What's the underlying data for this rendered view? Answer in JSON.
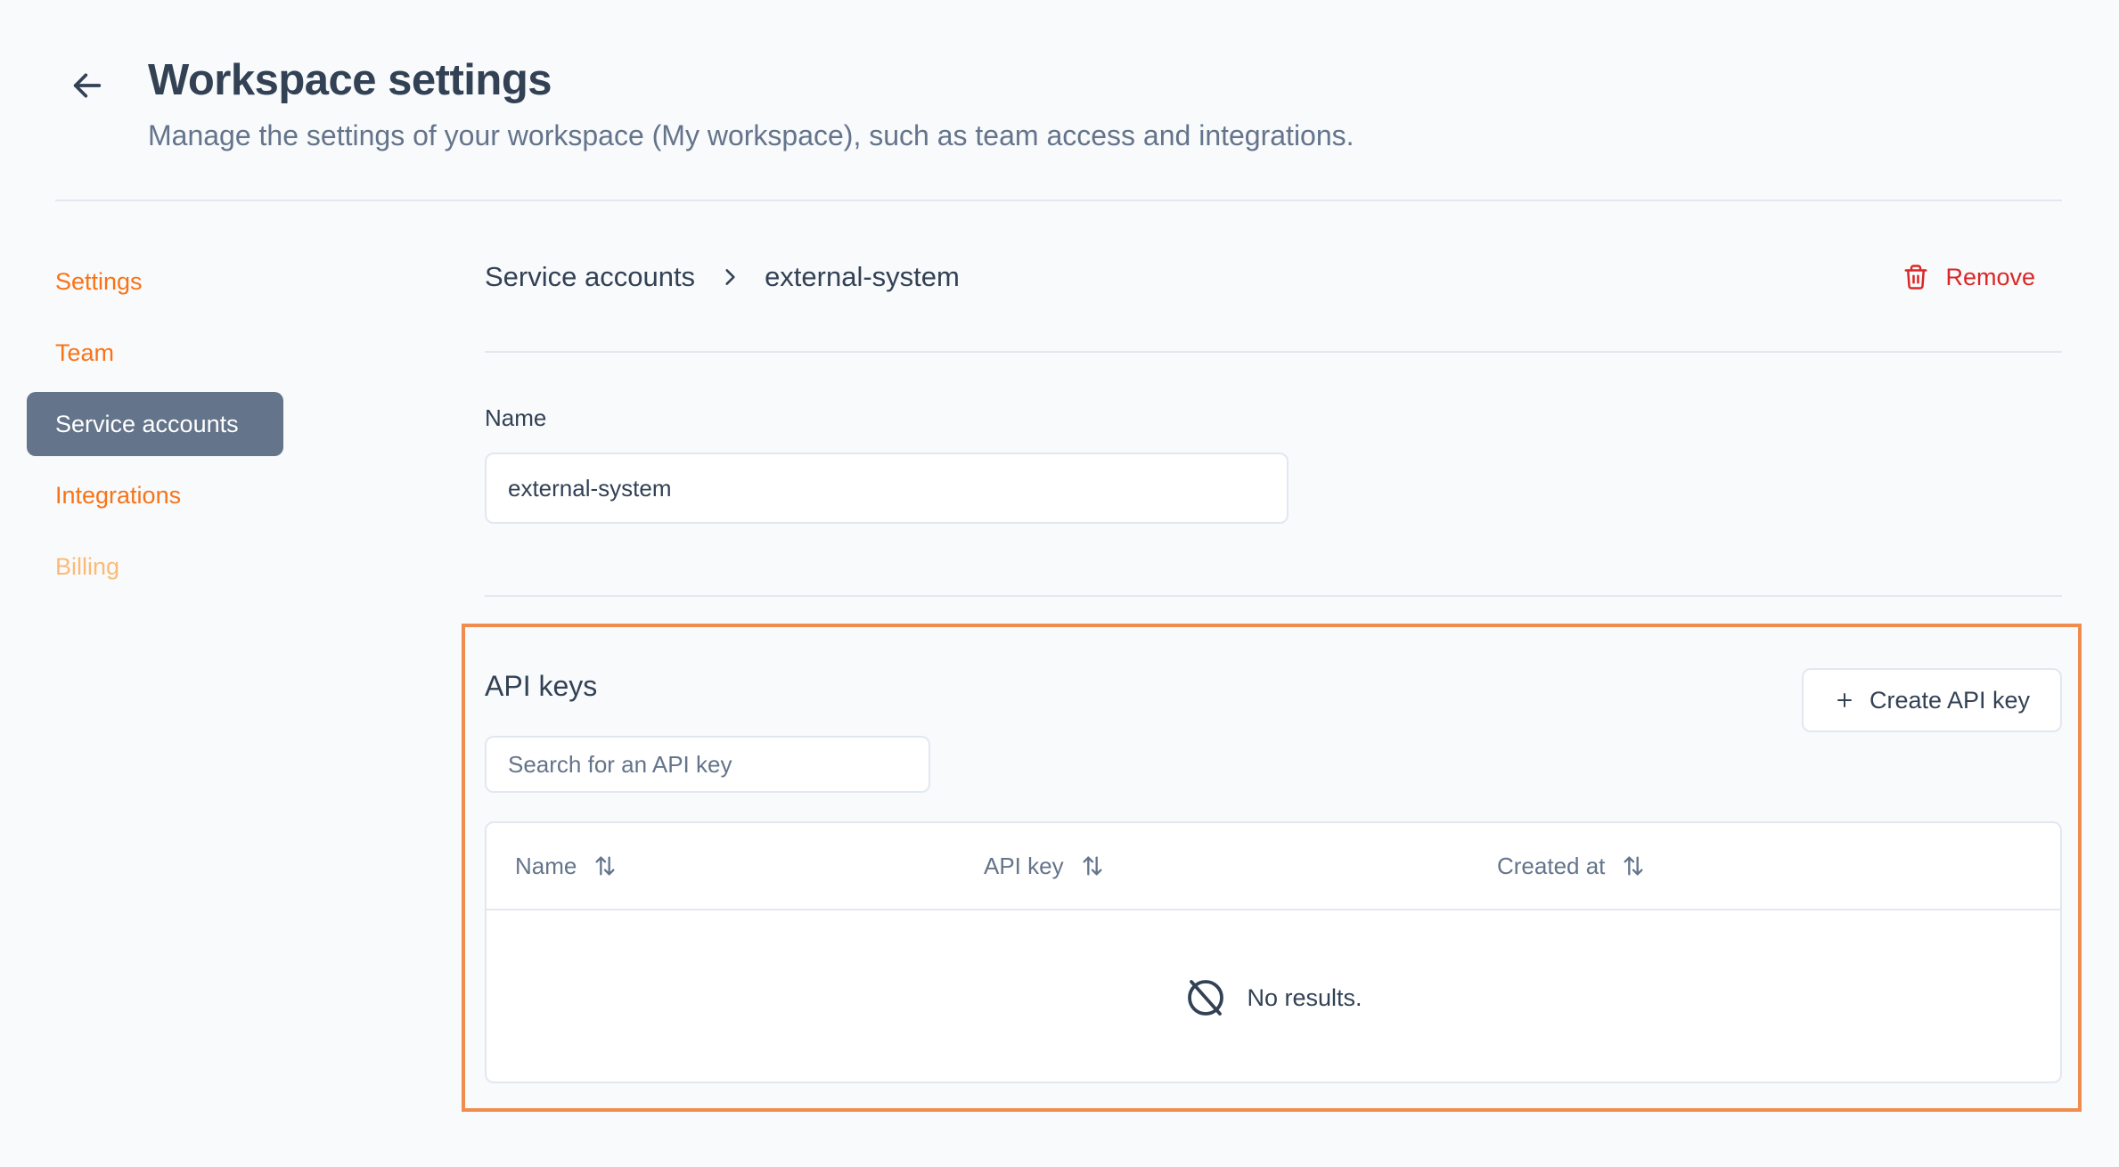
{
  "header": {
    "title": "Workspace settings",
    "subtitle": "Manage the settings of your workspace (My workspace), such as team access and integrations.",
    "back_icon": "arrow-left-icon"
  },
  "sidebar": {
    "items": [
      {
        "label": "Settings",
        "state": "default"
      },
      {
        "label": "Team",
        "state": "default"
      },
      {
        "label": "Service accounts",
        "state": "active"
      },
      {
        "label": "Integrations",
        "state": "default"
      },
      {
        "label": "Billing",
        "state": "disabled"
      }
    ]
  },
  "breadcrumb": {
    "parent": "Service accounts",
    "current": "external-system",
    "separator_icon": "chevron-right-icon"
  },
  "actions": {
    "remove_label": "Remove",
    "remove_icon": "trash-icon"
  },
  "form": {
    "name_label": "Name",
    "name_value": "external-system"
  },
  "api_keys": {
    "title": "API keys",
    "create_label": "Create API key",
    "create_icon": "plus-icon",
    "search_placeholder": "Search for an API key",
    "columns": [
      "Name",
      "API key",
      "Created at"
    ],
    "sort_icon": "sort-arrows-icon",
    "rows": [],
    "empty_text": "No results.",
    "empty_icon": "no-results-icon"
  },
  "colors": {
    "accent": "#f97316",
    "active_nav_bg": "#64748b",
    "danger": "#dc2626",
    "highlight_border": "#f08c4e"
  }
}
